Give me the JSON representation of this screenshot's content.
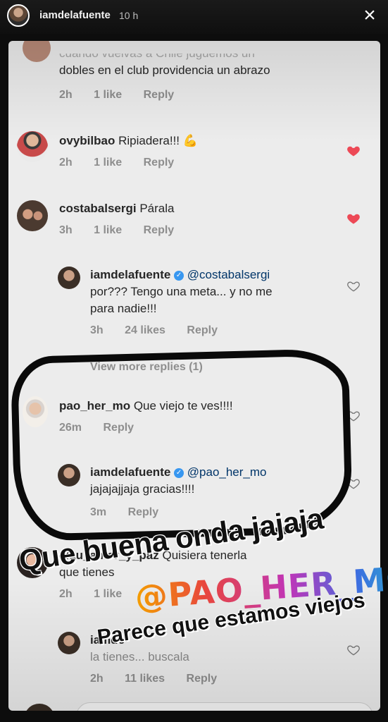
{
  "story": {
    "username": "iamdelafuente",
    "time": "10 h",
    "close_icon": "close-icon"
  },
  "comments": [
    {
      "text_line1": "cuando vuelvas a Chile juguemos un",
      "text_line2": "dobles en el club providencia un abrazo",
      "time": "2h",
      "likes": "1 like",
      "reply": "Reply"
    },
    {
      "username": "ovybilbao",
      "text": "Ripiadera!!!",
      "emoji": "💪",
      "time": "2h",
      "likes": "1 like",
      "reply": "Reply",
      "liked": true
    },
    {
      "username": "costabalsergi",
      "text": "Párala",
      "time": "3h",
      "likes": "1 like",
      "reply": "Reply",
      "liked": true
    },
    {
      "username": "iamdelafuente",
      "mention": "@costabalsergi",
      "text_line1": "por??? Tengo una meta... y no me",
      "text_line2": "para nadie!!!",
      "time": "3h",
      "likes": "24 likes",
      "reply": "Reply",
      "liked": false
    },
    {
      "view_more": "View more replies (1)"
    },
    {
      "username": "pao_her_mo",
      "text": "Que viejo te ves!!!!",
      "time": "26m",
      "reply": "Reply",
      "liked": false
    },
    {
      "username": "iamdelafuente",
      "mention": "@pao_her_mo",
      "text_line2": "jajajajjaja gracias!!!!",
      "time": "3m",
      "reply": "Reply",
      "liked": false
    },
    {
      "username": "clau_amor_y_paz",
      "text": "Quisiera tenerla",
      "text_line2": "que tienes",
      "time": "2h",
      "likes": "1 like"
    },
    {
      "username": "iamde",
      "text_line2": "la tienes... buscala",
      "time": "2h",
      "likes": "11 likes",
      "reply": "Reply"
    }
  ],
  "stickers": {
    "line1": "Que buena onda jajaja",
    "line2": "@PAO_HER_MO",
    "line3": "Parece que estamos viejos"
  },
  "colors": {
    "liked_heart": "#ed4956",
    "link": "#003569",
    "meta": "#8e8e8e"
  }
}
